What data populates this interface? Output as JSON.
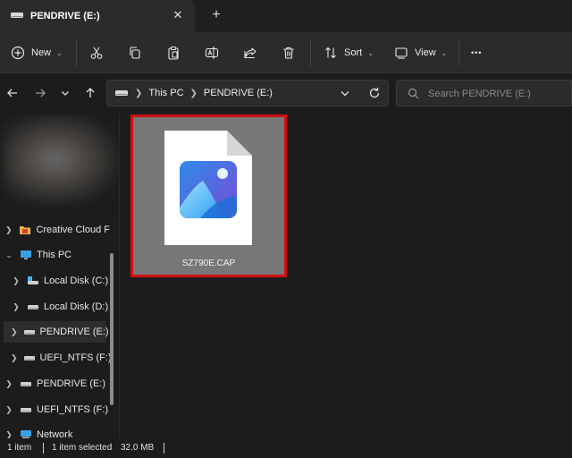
{
  "tab": {
    "title": "PENDRIVE (E:)",
    "close_glyph": "✕",
    "new_tab_glyph": "+"
  },
  "toolbar": {
    "new_label": "New",
    "sort_label": "Sort",
    "view_label": "View",
    "more_glyph": "•••",
    "icons": [
      "plus-circle-icon",
      "cut-icon",
      "copy-icon",
      "paste-icon",
      "rename-icon",
      "share-icon",
      "delete-icon",
      "sort-icon",
      "view-icon",
      "more-icon"
    ]
  },
  "address": {
    "crumbs": [
      "This PC",
      "PENDRIVE (E:)"
    ],
    "search_placeholder": "Search PENDRIVE (E:)"
  },
  "sidebar": {
    "items": [
      {
        "label": "Creative Cloud F",
        "icon": "creative-cloud-folder-icon",
        "expanded": false
      },
      {
        "label": "This PC",
        "icon": "monitor-icon",
        "expanded": true
      },
      {
        "label": "Local Disk (C:)",
        "icon": "windows-drive-icon",
        "expanded": false
      },
      {
        "label": "Local Disk (D:)",
        "icon": "drive-icon",
        "expanded": false
      },
      {
        "label": "PENDRIVE (E:)",
        "icon": "drive-icon",
        "expanded": false,
        "selected": true
      },
      {
        "label": "UEFI_NTFS (F:)",
        "icon": "drive-icon",
        "expanded": false
      },
      {
        "label": "PENDRIVE (E:)",
        "icon": "drive-icon",
        "expanded": false
      },
      {
        "label": "UEFI_NTFS (F:)",
        "icon": "drive-icon",
        "expanded": false
      },
      {
        "label": "Network",
        "icon": "network-icon",
        "expanded": false
      }
    ]
  },
  "files": [
    {
      "name": "SZ790E.CAP",
      "icon": "image-file-icon",
      "selected": true
    }
  ],
  "status": {
    "item_count": "1 item",
    "selected": "1 item selected",
    "size": "32.0 MB"
  },
  "colors": {
    "accent_selection": "#d01010",
    "window_bg": "#1c1c1c",
    "toolbar_bg": "#2b2b2b",
    "image_icon_gradient_start": "#2d8be8",
    "image_icon_gradient_end": "#7a4ad8"
  }
}
